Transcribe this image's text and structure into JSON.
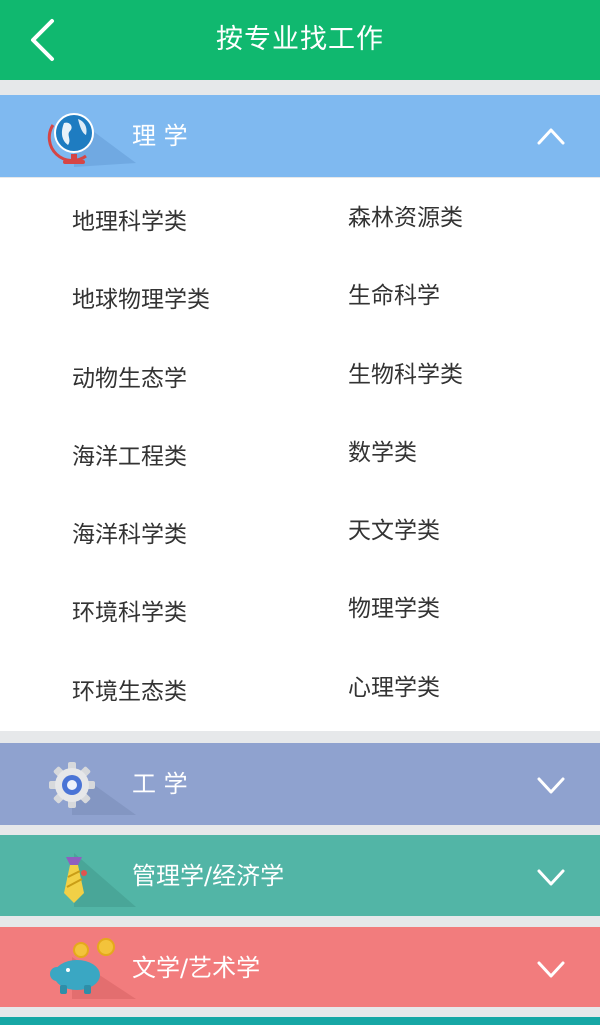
{
  "header": {
    "title": "按专业找工作",
    "back_icon": "chevron-left-icon"
  },
  "colors": {
    "topbar": "#10b86f",
    "science": "#7fb9f0",
    "engineering": "#8fa2cf",
    "management": "#52b5a6",
    "arts": "#f27c7d",
    "page_bg": "#e6e8ea"
  },
  "categories": {
    "science": {
      "label": "理 学",
      "icon": "globe-icon",
      "state": "expanded"
    },
    "engineering": {
      "label": "工 学",
      "icon": "gear-icon",
      "state": "collapsed"
    },
    "management": {
      "label": "管理学/经济学",
      "icon": "tie-icon",
      "state": "collapsed"
    },
    "arts": {
      "label": "文学/艺术学",
      "icon": "piggy-bank-icon",
      "state": "collapsed"
    }
  },
  "science_items": {
    "left": [
      "地理科学类",
      "地球物理学类",
      "动物生态学",
      "海洋工程类",
      "海洋科学类",
      "环境科学类",
      "环境生态类"
    ],
    "right": [
      "森林资源类",
      "生命科学",
      "生物科学类",
      "数学类",
      "天文学类",
      "物理学类",
      "心理学类"
    ]
  }
}
